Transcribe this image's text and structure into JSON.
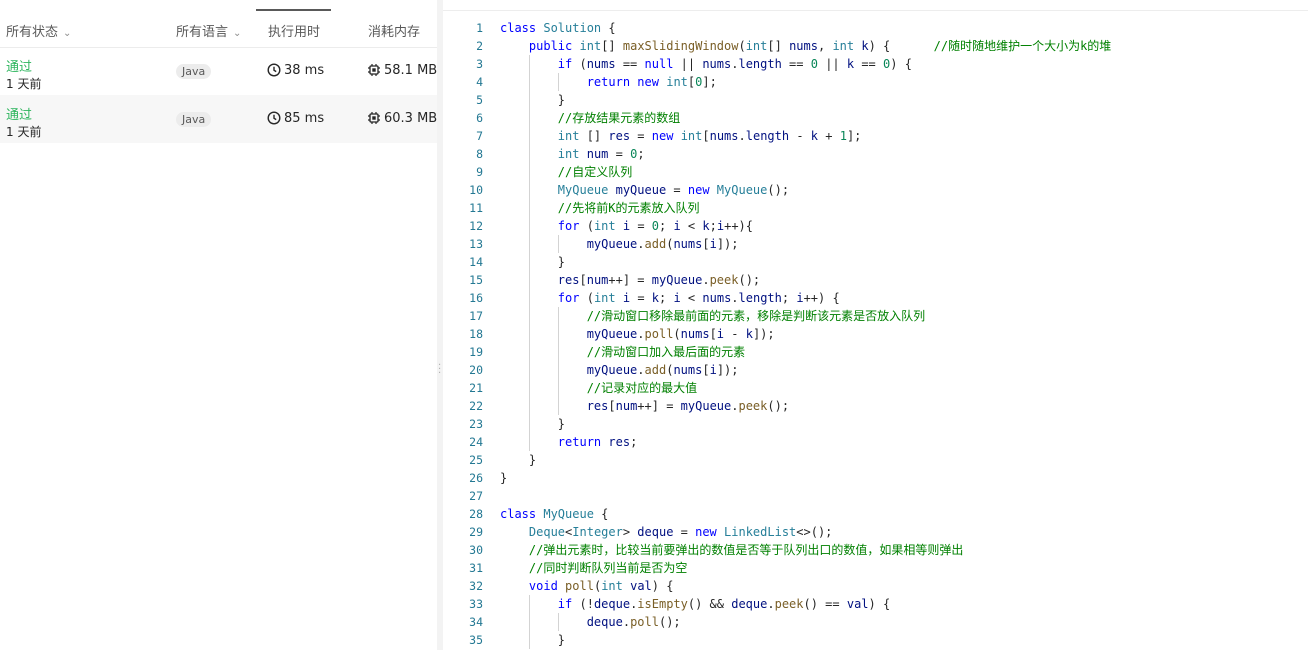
{
  "submissions": {
    "headers": {
      "status": "所有状态",
      "language": "所有语言",
      "runtime": "执行用时",
      "memory": "消耗内存"
    },
    "rows": [
      {
        "status": "通过",
        "time_ago": "1 天前",
        "language": "Java",
        "runtime": "38 ms",
        "memory": "58.1 MB"
      },
      {
        "status": "通过",
        "time_ago": "1 天前",
        "language": "Java",
        "runtime": "85 ms",
        "memory": "60.3 MB"
      }
    ]
  },
  "colors": {
    "accepted": "#2db55d",
    "keyword": "#0000ff",
    "comment": "#008000",
    "type": "#267f99",
    "number": "#098658",
    "function": "#795e26",
    "line_number": "#237893"
  },
  "code": {
    "lines": [
      "class Solution {",
      "    public int[] maxSlidingWindow(int[] nums, int k) {      //随时随地维护一个大小为k的堆",
      "        if (nums == null || nums.length == 0 || k == 0) {",
      "            return new int[0];",
      "        }",
      "        //存放结果元素的数组",
      "        int [] res = new int[nums.length - k + 1];",
      "        int num = 0;",
      "        //自定义队列",
      "        MyQueue myQueue = new MyQueue();",
      "        //先将前K的元素放入队列",
      "        for (int i = 0; i < k;i++){",
      "            myQueue.add(nums[i]);",
      "        }",
      "        res[num++] = myQueue.peek();",
      "        for (int i = k; i < nums.length; i++) {",
      "            //滑动窗口移除最前面的元素，移除是判断该元素是否放入队列",
      "            myQueue.poll(nums[i - k]);",
      "            //滑动窗口加入最后面的元素",
      "            myQueue.add(nums[i]);",
      "            //记录对应的最大值",
      "            res[num++] = myQueue.peek();",
      "        }",
      "        return res;",
      "    }",
      "}",
      "",
      "class MyQueue {",
      "    Deque<Integer> deque = new LinkedList<>();",
      "    //弹出元素时，比较当前要弹出的数值是否等于队列出口的数值，如果相等则弹出",
      "    //同时判断队列当前是否为空",
      "    void poll(int val) {",
      "        if (!deque.isEmpty() && deque.peek() == val) {",
      "            deque.poll();",
      "        }"
    ],
    "line_numbers": [
      "1",
      "2",
      "3",
      "4",
      "5",
      "6",
      "7",
      "8",
      "9",
      "10",
      "11",
      "12",
      "13",
      "14",
      "15",
      "16",
      "17",
      "18",
      "19",
      "20",
      "21",
      "22",
      "23",
      "24",
      "25",
      "26",
      "27",
      "28",
      "29",
      "30",
      "31",
      "32",
      "33",
      "34",
      "35"
    ]
  }
}
